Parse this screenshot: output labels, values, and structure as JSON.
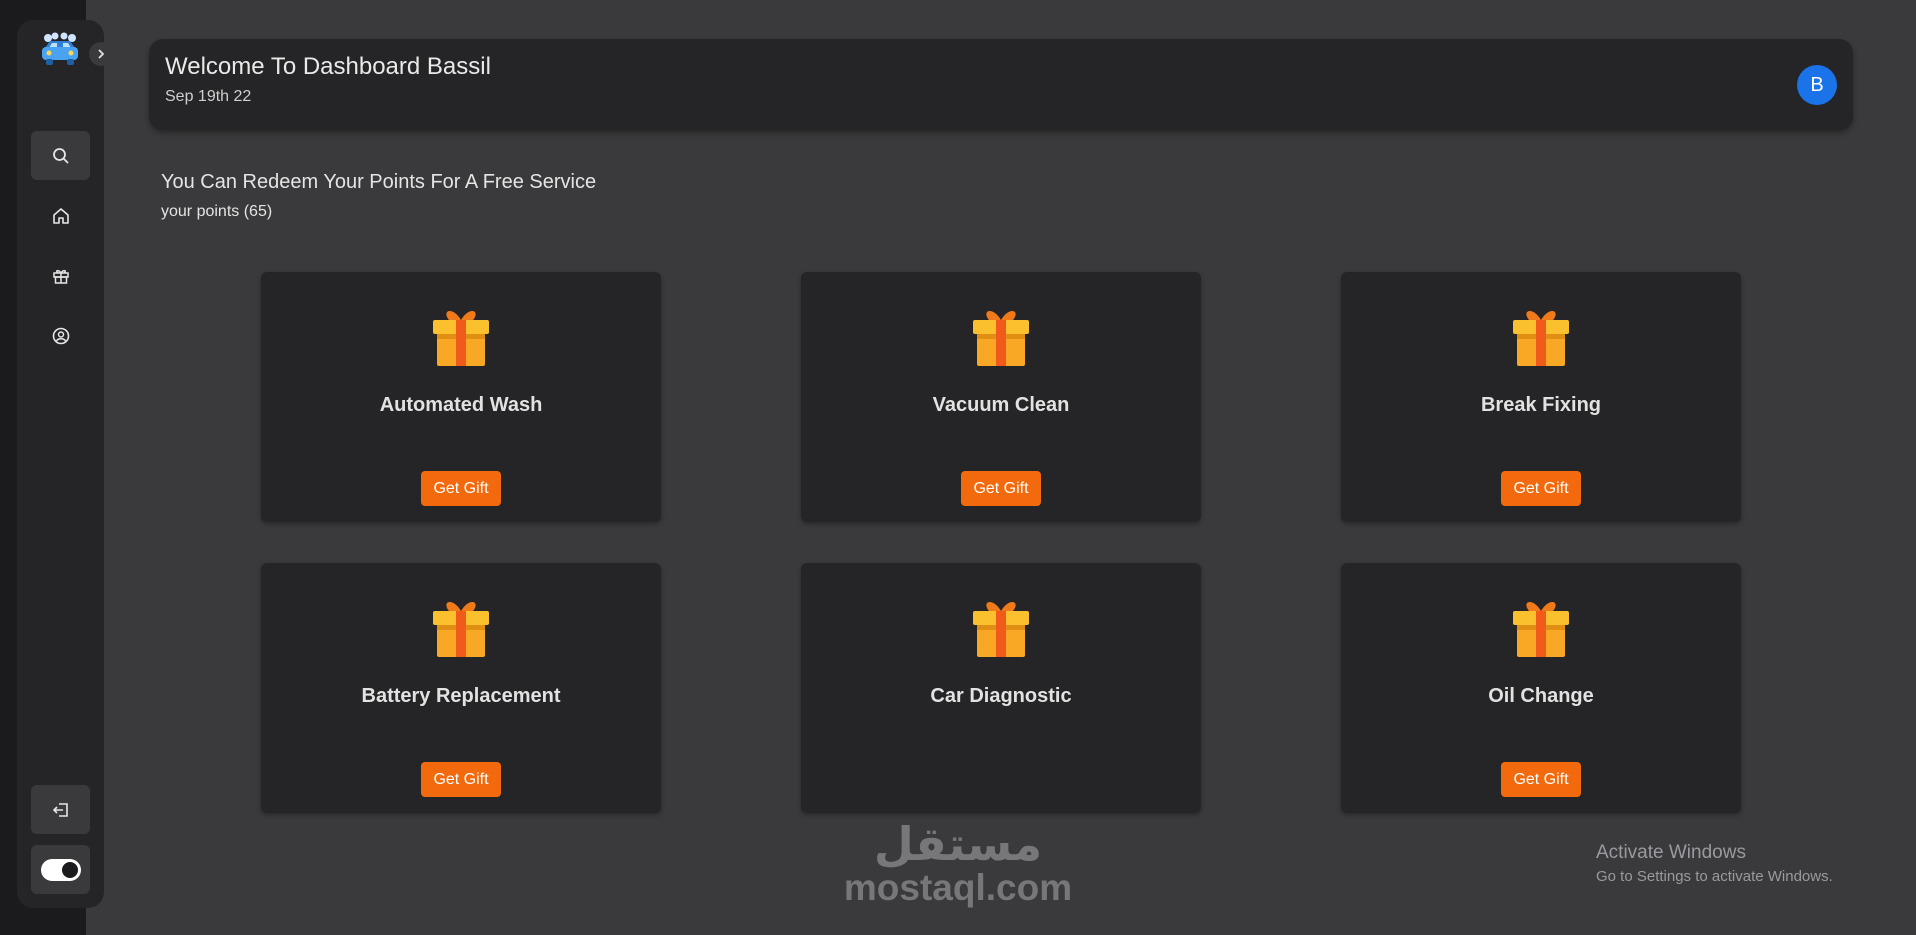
{
  "sidebar": {
    "logo_icon": "car-wash-icon",
    "expand_icon": "chevron-right-icon",
    "items": [
      {
        "name": "search",
        "icon": "search-icon"
      },
      {
        "name": "home",
        "icon": "home-icon"
      },
      {
        "name": "gifts",
        "icon": "gift-icon"
      },
      {
        "name": "profile",
        "icon": "user-circle-icon"
      }
    ],
    "logout_icon": "logout-icon",
    "theme_toggle_icon": "toggle-icon"
  },
  "header": {
    "title": "Welcome To Dashboard Bassil",
    "date": "Sep 19th 22",
    "avatar_initial": "B"
  },
  "intro": {
    "title": "You Can Redeem Your Points For A Free Service",
    "points": "your points (65)"
  },
  "cards": [
    {
      "title": "Automated Wash",
      "button": "Get Gift"
    },
    {
      "title": "Vacuum Clean",
      "button": "Get Gift"
    },
    {
      "title": "Break Fixing",
      "button": "Get Gift"
    },
    {
      "title": "Battery Replacement",
      "button": "Get Gift"
    },
    {
      "title": "Car Diagnostic",
      "button": ""
    },
    {
      "title": "Oil Change",
      "button": "Get Gift"
    }
  ],
  "watermark": {
    "arabic": "مستقل",
    "latin": "mostaql.com"
  },
  "activate_windows": {
    "title": "Activate Windows",
    "subtitle": "Go to Settings to activate Windows."
  },
  "colors": {
    "accent": "#f26a0d",
    "avatar": "#1a73e8",
    "background": "#3a3a3c",
    "panel": "#252527"
  }
}
